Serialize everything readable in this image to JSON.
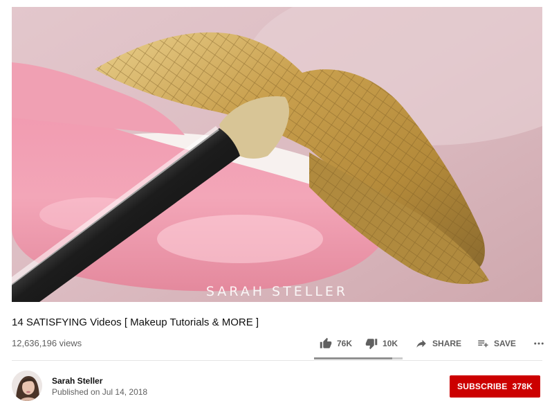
{
  "video": {
    "watermark": "SARAH STELLER",
    "title": "14 SATISFYING Videos [ Makeup Tutorials & MORE ]",
    "views": "12,636,196 views"
  },
  "actions": {
    "like_count": "76K",
    "dislike_count": "10K",
    "share_label": "SHARE",
    "save_label": "SAVE",
    "like_ratio": 0.88
  },
  "channel": {
    "name": "Sarah Steller",
    "published": "Published on Jul 14, 2018",
    "subscribe_label": "SUBSCRIBE",
    "subscriber_count": "378K"
  },
  "colors": {
    "subscribe_bg": "#cc0000",
    "icon_gray": "#606060"
  },
  "icons": [
    "thumbs-up-icon",
    "thumbs-down-icon",
    "share-arrow-icon",
    "playlist-add-icon",
    "more-icon"
  ]
}
